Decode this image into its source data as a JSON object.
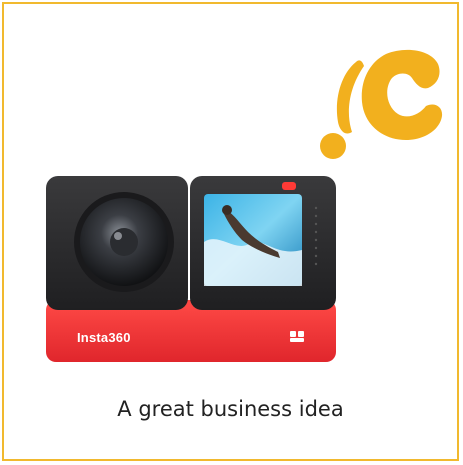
{
  "product": {
    "brand_label": "Insta360"
  },
  "caption": "A great business idea",
  "logo": {
    "icon": "c-swoosh-logo",
    "color": "#f2b01e"
  },
  "colors": {
    "frame_border": "#f1b92e",
    "camera_body": "#2b2b2d",
    "camera_base": "#f0373a"
  }
}
